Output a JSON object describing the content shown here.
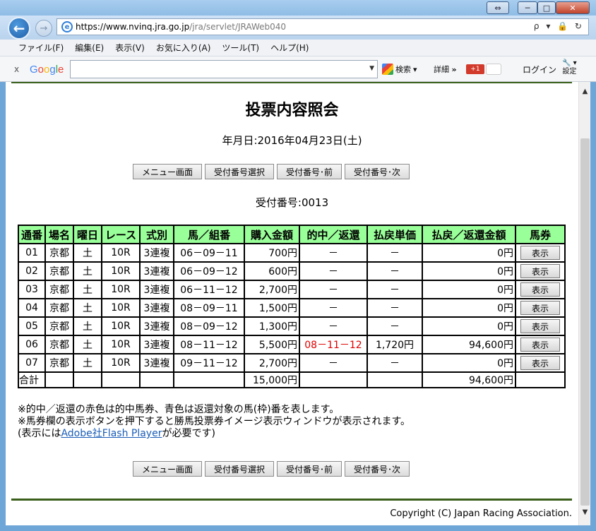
{
  "browser": {
    "url_host": "https://www.nvinq.jra.go.jp",
    "url_path": "/jra/servlet/JRAWeb040",
    "url_icons": "ρ ▾ 🔒 ↻",
    "menu": [
      "ファイル(F)",
      "編集(E)",
      "表示(V)",
      "お気に入り(A)",
      "ツール(T)",
      "ヘルプ(H)"
    ],
    "toolbar": {
      "close": "x",
      "google": "Google",
      "search_label": "検索",
      "details_label": "詳細",
      "more_glyph": "»",
      "plus_label": "+1",
      "login_label": "ログイン",
      "settings_label": "設定"
    }
  },
  "page": {
    "title": "投票内容照会",
    "date_label": "年月日:",
    "date_value": "2016年04月23日(土)",
    "buttons": [
      "メニュー画面",
      "受付番号選択",
      "受付番号･前",
      "受付番号･次"
    ],
    "receipt_label": "受付番号:",
    "receipt_value": "0013",
    "table": {
      "headers": [
        "通番",
        "場名",
        "曜日",
        "レース",
        "式別",
        "馬／組番",
        "購入金額",
        "的中／返還",
        "払戻単価",
        "払戻／返還金額",
        "馬券"
      ],
      "rows": [
        {
          "no": "01",
          "venue": "京都",
          "day": "土",
          "race": "10R",
          "type": "3連複",
          "combo": "06－09－11",
          "amount": "700円",
          "hit": "－",
          "unit": "－",
          "payout": "0円",
          "button": "表示"
        },
        {
          "no": "02",
          "venue": "京都",
          "day": "土",
          "race": "10R",
          "type": "3連複",
          "combo": "06－09－12",
          "amount": "600円",
          "hit": "－",
          "unit": "－",
          "payout": "0円",
          "button": "表示"
        },
        {
          "no": "03",
          "venue": "京都",
          "day": "土",
          "race": "10R",
          "type": "3連複",
          "combo": "06－11－12",
          "amount": "2,700円",
          "hit": "－",
          "unit": "－",
          "payout": "0円",
          "button": "表示"
        },
        {
          "no": "04",
          "venue": "京都",
          "day": "土",
          "race": "10R",
          "type": "3連複",
          "combo": "08－09－11",
          "amount": "1,500円",
          "hit": "－",
          "unit": "－",
          "payout": "0円",
          "button": "表示"
        },
        {
          "no": "05",
          "venue": "京都",
          "day": "土",
          "race": "10R",
          "type": "3連複",
          "combo": "08－09－12",
          "amount": "1,300円",
          "hit": "－",
          "unit": "－",
          "payout": "0円",
          "button": "表示"
        },
        {
          "no": "06",
          "venue": "京都",
          "day": "土",
          "race": "10R",
          "type": "3連複",
          "combo": "08－11－12",
          "amount": "5,500円",
          "hit": "08－11－12",
          "unit": "1,720円",
          "payout": "94,600円",
          "button": "表示"
        },
        {
          "no": "07",
          "venue": "京都",
          "day": "土",
          "race": "10R",
          "type": "3連複",
          "combo": "09－11－12",
          "amount": "2,700円",
          "hit": "－",
          "unit": "－",
          "payout": "0円",
          "button": "表示"
        }
      ],
      "total": {
        "label": "合計",
        "amount": "15,000円",
        "payout": "94,600円"
      }
    },
    "notes": {
      "line1": "※的中／返還の赤色は的中馬券、青色は返還対象の馬(枠)番を表します。",
      "line2": "※馬券欄の表示ボタンを押下すると勝馬投票券イメージ表示ウィンドウが表示されます。",
      "line3_pre": "(表示には",
      "line3_link": "Adobe社Flash Player",
      "line3_post": "が必要です)"
    },
    "copyright": "Copyright (C) Japan Racing Association."
  },
  "colors": {
    "header_bg": "#99ff99",
    "hit_red": "#e00000",
    "rule_green": "#3a5f1a"
  }
}
